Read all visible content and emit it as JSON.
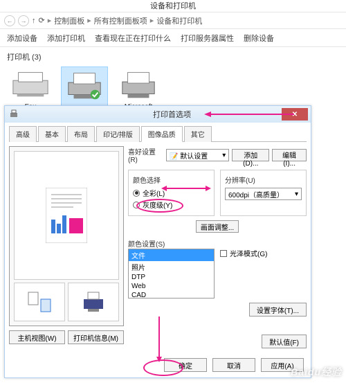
{
  "explorer": {
    "window_title": "设备和打印机",
    "breadcrumb": [
      "控制面板",
      "所有控制面板项",
      "设备和打印机"
    ],
    "toolbar": {
      "add_device": "添加设备",
      "add_printer": "添加打印机",
      "see_printing": "查看现在正在打印什么",
      "server_props": "打印服务器属性",
      "remove_device": "删除设备"
    },
    "section": {
      "label": "打印机",
      "count": 3
    },
    "devices": [
      {
        "name": "Fax"
      },
      {
        "name": ""
      },
      {
        "name": "Microsoft XPS"
      }
    ]
  },
  "dialog": {
    "title": "打印首选项",
    "tabs": [
      "高级",
      "基本",
      "布局",
      "印记/排版",
      "图像品质",
      "其它"
    ],
    "active_tab": 4,
    "favorites": {
      "label": "喜好设置(R)",
      "selected": "默认设置",
      "add_btn": "添加(D)...",
      "edit_btn": "编辑(I)..."
    },
    "color_select": {
      "title": "颜色选择",
      "full_color": "全彩(L)",
      "grayscale": "灰度级(Y)",
      "adjust_btn": "画面调整..."
    },
    "resolution": {
      "title": "分辨率(U)",
      "value": "600dpi（高质量）"
    },
    "color_settings": {
      "title": "颜色设置(S)",
      "items": [
        "文件",
        "照片",
        "DTP",
        "Web",
        "CAD"
      ],
      "selected_index": 0
    },
    "gloss": {
      "label": "光泽模式(G)",
      "checked": false
    },
    "font_btn": "设置字体(T)...",
    "defaults_btn": "默认值(F)",
    "preview": {
      "host_btn": "主机视图(W)",
      "info_btn": "打印机信息(M)"
    },
    "footer": {
      "ok": "确定",
      "cancel": "取消",
      "apply": "应用(A)"
    }
  },
  "watermark": "Baidu经验"
}
